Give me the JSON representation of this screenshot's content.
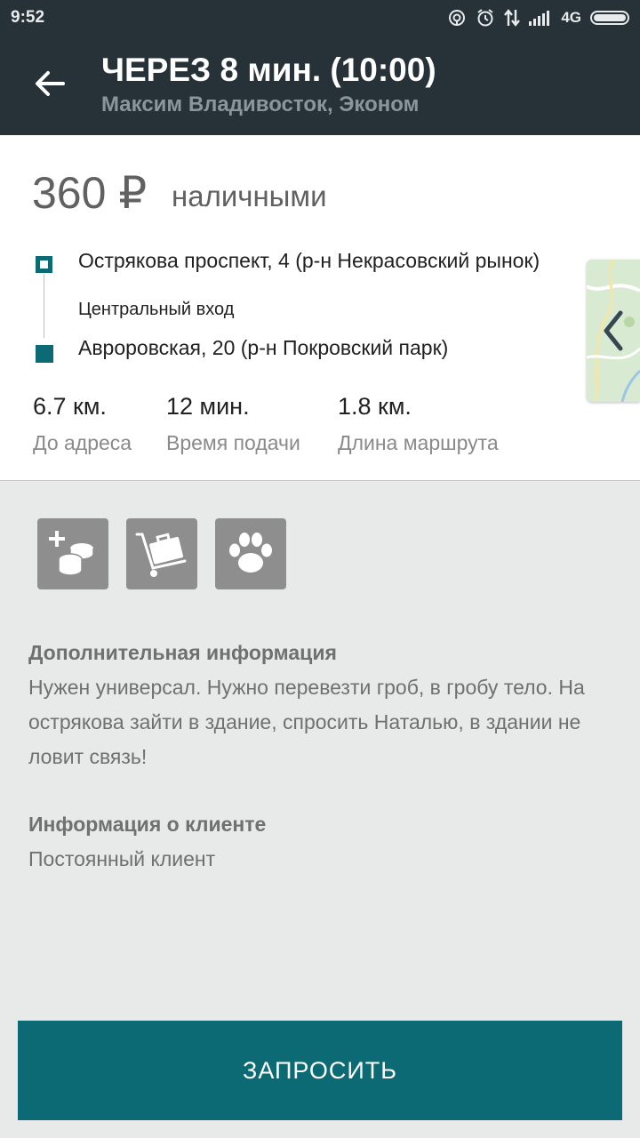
{
  "status_bar": {
    "time": "9:52",
    "network": "4G"
  },
  "header": {
    "title": "ЧЕРЕЗ 8 мин. (10:00)",
    "subtitle": "Максим Владивосток, Эконом"
  },
  "order": {
    "price": "360 ₽",
    "payment": "наличными",
    "from": {
      "address": "Острякова проспект, 4 (р-н Некрасовский рынок)",
      "note": "Центральный вход"
    },
    "to": {
      "address": "Авроровская, 20 (р-н Покровский парк)"
    },
    "stats": [
      {
        "value": "6.7 км.",
        "label": "До адреса"
      },
      {
        "value": "12 мин.",
        "label": "Время подачи"
      },
      {
        "value": "1.8 км.",
        "label": "Длина маршрута"
      }
    ]
  },
  "options": [
    {
      "icon": "coins-plus-icon"
    },
    {
      "icon": "luggage-cart-icon"
    },
    {
      "icon": "paw-icon"
    }
  ],
  "additional_info": {
    "heading": "Дополнительная информация",
    "text": "Нужен универсал. Нужно перевезти гроб, в гробу тело. На острякова зайти в здание, спросить Наталью, в здании не ловит связь!"
  },
  "client_info": {
    "heading": "Информация о клиенте",
    "text": "Постоянный клиент"
  },
  "actions": {
    "request_label": "ЗАПРОСИТЬ"
  },
  "colors": {
    "accent": "#0b6a74",
    "appbar": "#263238"
  }
}
